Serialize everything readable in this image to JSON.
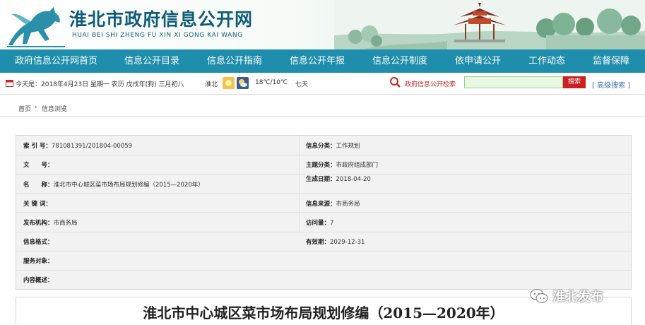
{
  "header": {
    "title": "淮北市政府信息公开网",
    "subtitle": "HUAI BEI SHI ZHENG FU XIN XI GONG KAI WANG"
  },
  "nav": {
    "items": [
      "政府信息公开网首页",
      "信息公开目录",
      "信息公开指南",
      "信息公开年报",
      "信息公开制度",
      "依申请公开",
      "工作动态",
      "监督保障"
    ]
  },
  "infobar": {
    "today": "今天是：2018年4月23日 星期一 农历 戊戌年(狗) 三月初八",
    "city": "淮北",
    "temperature": "18℃/10℃",
    "wind": "七天",
    "search_label": "政府信息公开检索",
    "search_button": "搜索",
    "advanced_search": "[ 高级搜索 ]"
  },
  "breadcrumb": {
    "home": "首页",
    "separator": "›",
    "current": "信息浏览"
  },
  "meta": {
    "index_label": "索 引 号：",
    "index_value": "781081391/201804-00059",
    "category_label": "信息分类：",
    "category_value": "工作规划",
    "docno_label": "文　　号：",
    "docno_value": "",
    "topic_label": "主题分类：",
    "topic_value": "市政府组成部门",
    "created_label": "生成日期：",
    "created_value": "2018-04-20",
    "name_label": "名　　称：",
    "name_value": "淮北市中心城区菜市场布局规划修编（2015—2020年）",
    "keywords_label": "关 键 词：",
    "keywords_value": "",
    "source_label": "信息来源：",
    "source_value": "市商务局",
    "publisher_label": "发布机构：",
    "publisher_value": "市商务局",
    "visits_label": "访问量：",
    "visits_value": "7",
    "format_label": "信息格式：",
    "format_value": "",
    "expiry_label": "有效期：",
    "expiry_value": "2029-12-31",
    "target_label": "服务对象：",
    "target_value": "",
    "summary_label": "内容概述：",
    "summary_value": ""
  },
  "document": {
    "title": "淮北市中心城区菜市场布局规划修编（2015—2020年）"
  },
  "watermark": {
    "text": "淮北发布"
  },
  "colors": {
    "nav_bg": "#1f8eac",
    "title_color": "#0f5c79",
    "search_button_bg": "#cc1f1f",
    "search_label": "#c62828"
  }
}
